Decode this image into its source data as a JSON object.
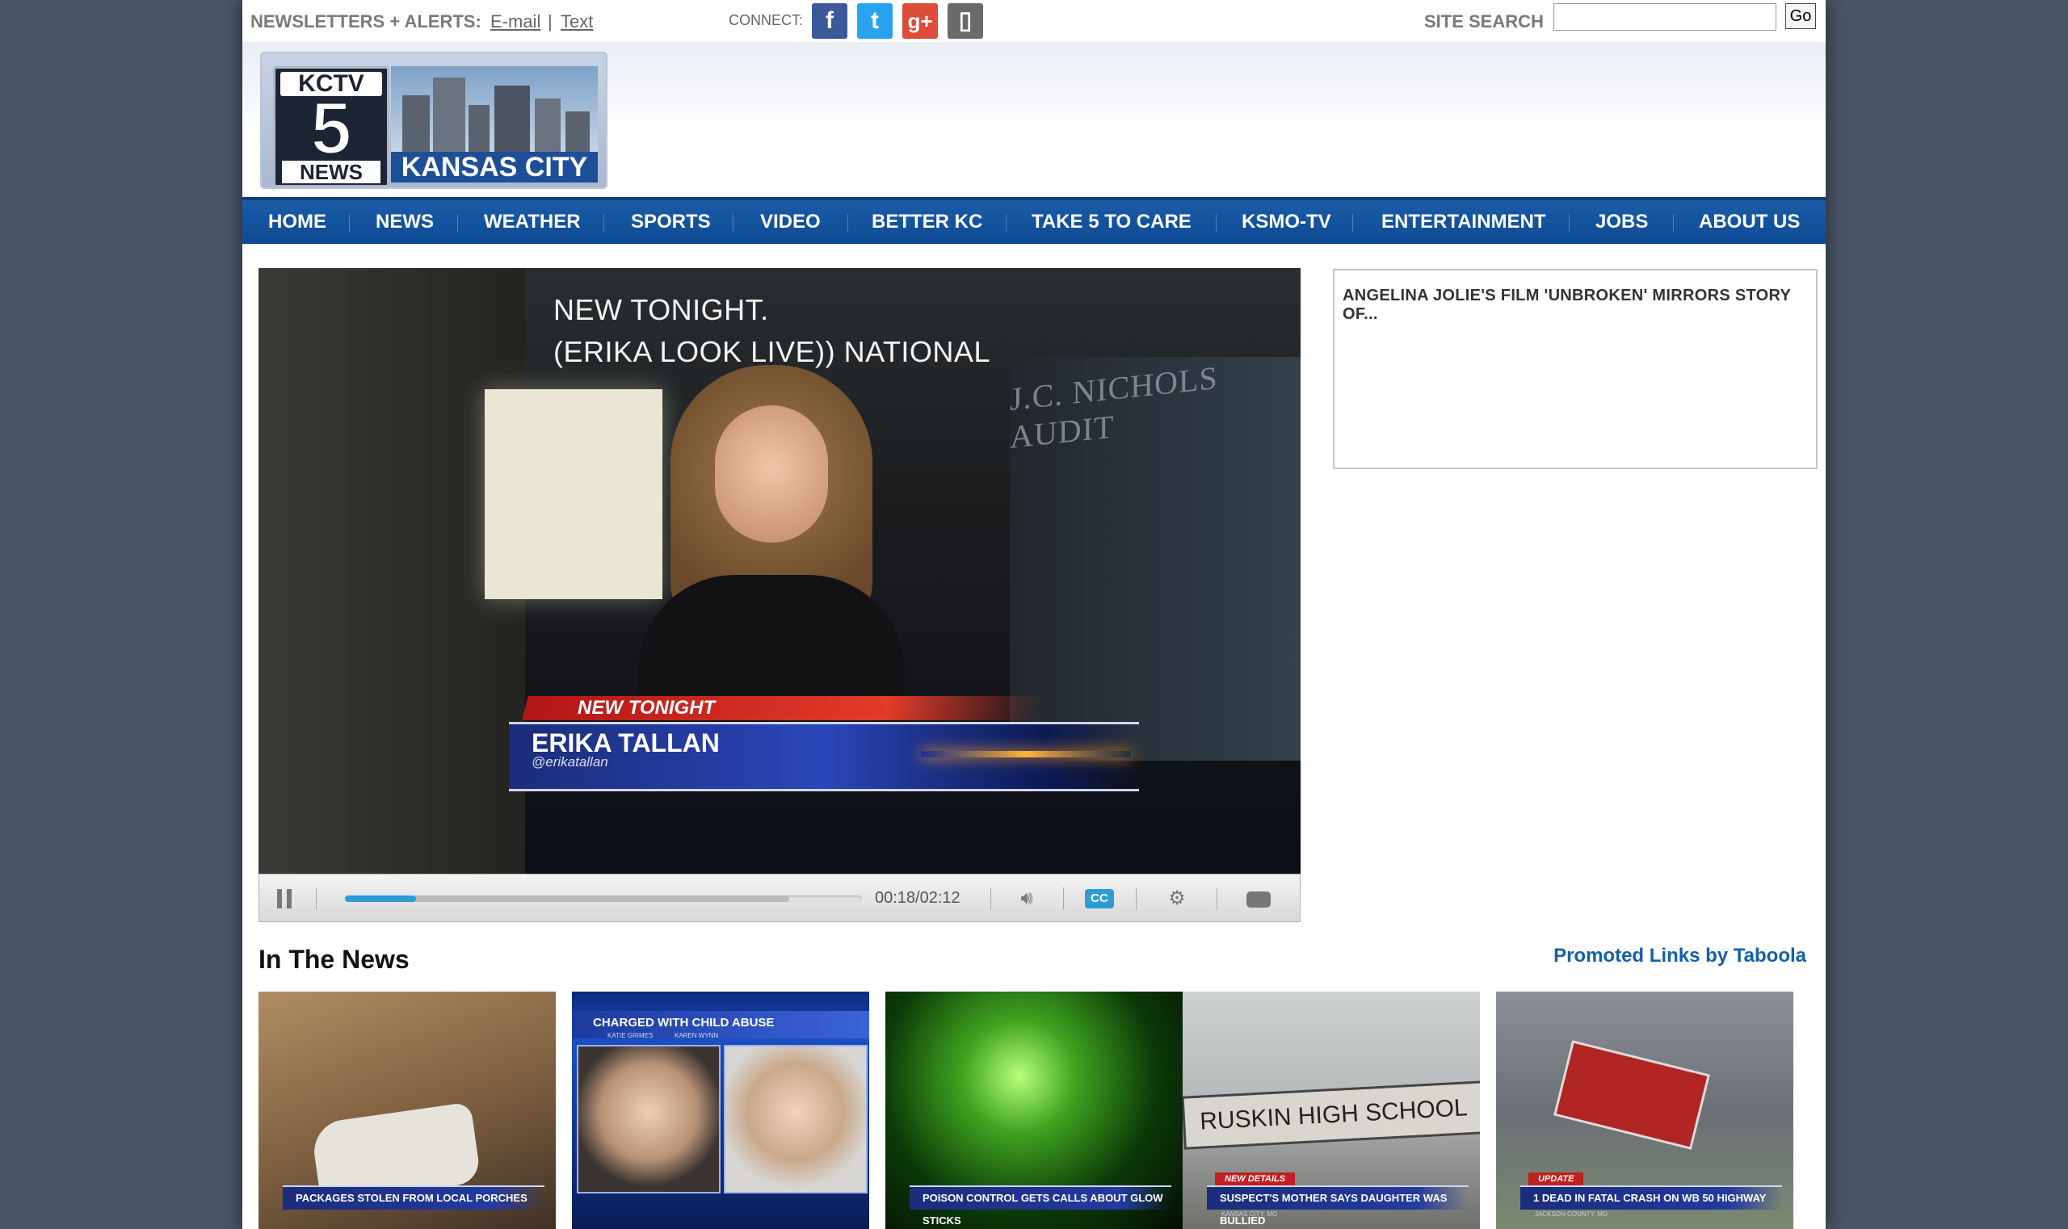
{
  "topbar": {
    "newsletters_label": "NEWSLETTERS + ALERTS:",
    "email_link": "E-mail",
    "separator": "|",
    "text_link": "Text",
    "connect_label": "CONNECT:",
    "social": [
      {
        "name": "facebook-icon",
        "glyph": "f",
        "color": "#3b5998"
      },
      {
        "name": "twitter-icon",
        "glyph": "t",
        "color": "#2aa3ef"
      },
      {
        "name": "google-plus-icon",
        "glyph": "g+",
        "color": "#dd4b39"
      },
      {
        "name": "mobile-icon",
        "glyph": "▯",
        "color": "#6a6a6a"
      }
    ],
    "site_search_label": "SITE SEARCH",
    "search_value": "",
    "go_label": "Go"
  },
  "logo": {
    "kctv": "KCTV",
    "five": "5",
    "news": "NEWS",
    "city": "KANSAS CITY"
  },
  "nav": [
    "HOME",
    "NEWS",
    "WEATHER",
    "SPORTS",
    "VIDEO",
    "BETTER KC",
    "TAKE 5 TO CARE",
    "KSMO-TV",
    "ENTERTAINMENT",
    "JOBS",
    "ABOUT US"
  ],
  "video": {
    "overlay_line1": "NEW TONIGHT.",
    "overlay_line2": "(ERIKA LOOK LIVE)) NATIONAL",
    "wall_text": "J.C. NICHOLS AUDIT",
    "lower_third_tag": "NEW TONIGHT",
    "lower_third_name": "ERIKA TALLAN",
    "lower_third_handle": "@erikatallan",
    "time": "00:18/02:12",
    "progress": 0.138,
    "buffered": 0.86,
    "cc_label": "CC"
  },
  "sidebar": {
    "headline": "ANGELINA JOLIE'S FILM 'UNBROKEN' MIRRORS STORY OF..."
  },
  "in_the_news": {
    "title": "In The News",
    "promoted": "Promoted Links by Taboola",
    "thumbs": [
      {
        "caption": "PACKAGES STOLEN FROM LOCAL PORCHES",
        "tag": "",
        "sub": ""
      },
      {
        "caption": "CHARGED WITH CHILD ABUSE",
        "tag": "",
        "sub": "KATIE GRIMES            KAREN WYNN"
      },
      {
        "caption": "POISON CONTROL GETS CALLS ABOUT GLOW STICKS",
        "tag": "",
        "sub": ""
      },
      {
        "caption": "SUSPECT'S MOTHER SAYS DAUGHTER WAS BULLIED",
        "tag": "NEW DETAILS",
        "sub": "KANSAS CITY, MO",
        "sign": "RUSKIN HIGH SCHOOL"
      },
      {
        "caption": "1 DEAD IN FATAL CRASH ON WB 50 HIGHWAY",
        "tag": "UPDATE",
        "sub": "JACKSON COUNTY, MO"
      }
    ]
  }
}
